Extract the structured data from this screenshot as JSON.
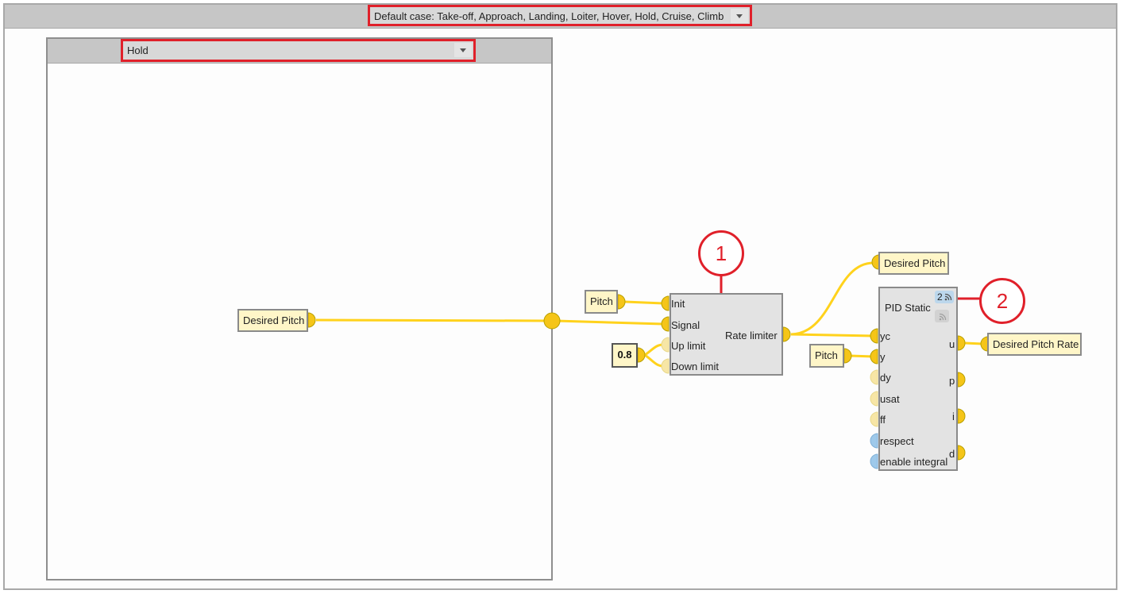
{
  "default_case": {
    "label": "Default case: Take-off, Approach, Landing, Loiter, Hover, Hold, Cruise, Climb"
  },
  "sub_case": {
    "label": "Hold"
  },
  "inner": {
    "desired_pitch": "Desired Pitch"
  },
  "inputs": {
    "pitch_a": "Pitch",
    "pitch_b": "Pitch",
    "constant": "0.8"
  },
  "rate_limiter": {
    "title": "Rate limiter",
    "ports": [
      "Init",
      "Signal",
      "Up limit",
      "Down limit"
    ]
  },
  "pid": {
    "title": "PID Static",
    "badge": "2",
    "inputs": [
      "yc",
      "y",
      "dy",
      "usat",
      "ff",
      "respect",
      "enable integral"
    ],
    "outputs": [
      "u",
      "p",
      "i",
      "d"
    ]
  },
  "outputs": {
    "desired_pitch": "Desired Pitch",
    "desired_pitch_rate": "Desired Pitch Rate"
  },
  "callouts": [
    "1",
    "2"
  ],
  "colors": {
    "wire": "#ffd21c",
    "port": "#f5c518",
    "port_faded": "#f7e6a6",
    "bool_port": "#9ec9ea",
    "highlight": "#e0202a"
  }
}
